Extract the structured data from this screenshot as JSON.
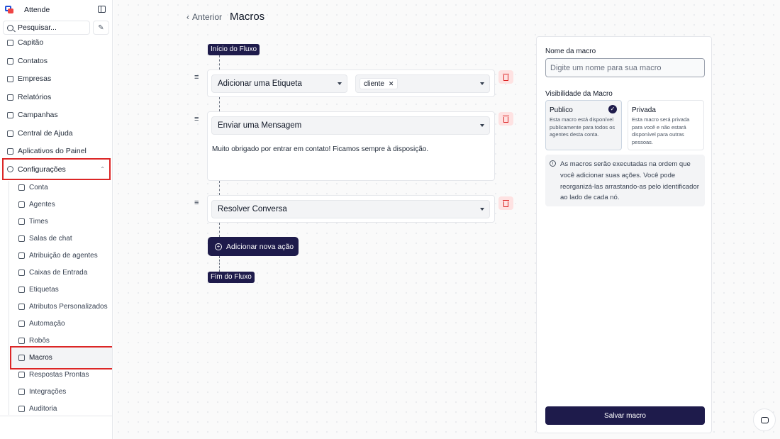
{
  "app": {
    "name": "Attende"
  },
  "sidebar": {
    "search_label": "Pesquisar...",
    "items": [
      {
        "label": "Capitão",
        "icon": "briefcase-icon"
      },
      {
        "label": "Contatos",
        "icon": "contact-card-icon"
      },
      {
        "label": "Empresas",
        "icon": "building-icon"
      },
      {
        "label": "Relatórios",
        "icon": "line-chart-icon"
      },
      {
        "label": "Campanhas",
        "icon": "megaphone-icon"
      },
      {
        "label": "Central de Ajuda",
        "icon": "library-icon"
      },
      {
        "label": "Aplicativos do Painel",
        "icon": "grid-plus-icon"
      }
    ],
    "config": {
      "label": "Configurações",
      "icon": "gear-icon",
      "expanded": true
    },
    "sub_items": [
      {
        "label": "Conta",
        "icon": "briefcase-icon"
      },
      {
        "label": "Agentes",
        "icon": "agent-icon"
      },
      {
        "label": "Times",
        "icon": "team-icon"
      },
      {
        "label": "Salas de chat",
        "icon": "chat-room-icon"
      },
      {
        "label": "Atribuição de agentes",
        "icon": "user-assign-icon"
      },
      {
        "label": "Caixas de Entrada",
        "icon": "inbox-icon"
      },
      {
        "label": "Etiquetas",
        "icon": "tag-icon"
      },
      {
        "label": "Atributos Personalizados",
        "icon": "code-icon"
      },
      {
        "label": "Automação",
        "icon": "automation-icon"
      },
      {
        "label": "Robôs",
        "icon": "bot-icon"
      },
      {
        "label": "Macros",
        "icon": "calendar-icon",
        "active": true
      },
      {
        "label": "Respostas Prontas",
        "icon": "canned-response-icon"
      },
      {
        "label": "Integrações",
        "icon": "integration-icon"
      },
      {
        "label": "Auditoria",
        "icon": "audit-icon"
      }
    ]
  },
  "header": {
    "back_label": "Anterior",
    "title": "Macros"
  },
  "flow": {
    "start_label": "Início do Fluxo",
    "end_label": "Fim do Fluxo",
    "actions": [
      {
        "type_label": "Adicionar uma Etiqueta",
        "tag": "cliente"
      },
      {
        "type_label": "Enviar uma Mensagem",
        "message": "Muito obrigado por entrar em contato! Ficamos sempre à disposição."
      },
      {
        "type_label": "Resolver Conversa"
      }
    ],
    "add_action_label": "Adicionar nova ação"
  },
  "panel": {
    "name_label": "Nome da macro",
    "name_placeholder": "Digite um nome para sua macro",
    "name_value": "",
    "visibility_label": "Visibilidade da Macro",
    "public": {
      "title": "Publico",
      "desc": "Esta macro está disponível publicamente para todos os agentes desta conta.",
      "selected": true
    },
    "private": {
      "title": "Privada",
      "desc": "Esta macro será privada para você e não estará disponível para outras pessoas.",
      "selected": false
    },
    "info": "As macros serão executadas na ordem que você adicionar suas ações. Você pode reorganizá-las arrastando-as pelo identificador ao lado de cada nó.",
    "save_label": "Salvar macro"
  },
  "colors": {
    "primary": "#1e1b4b",
    "highlight": "#dc2626",
    "danger_bg": "#fee2e2"
  }
}
